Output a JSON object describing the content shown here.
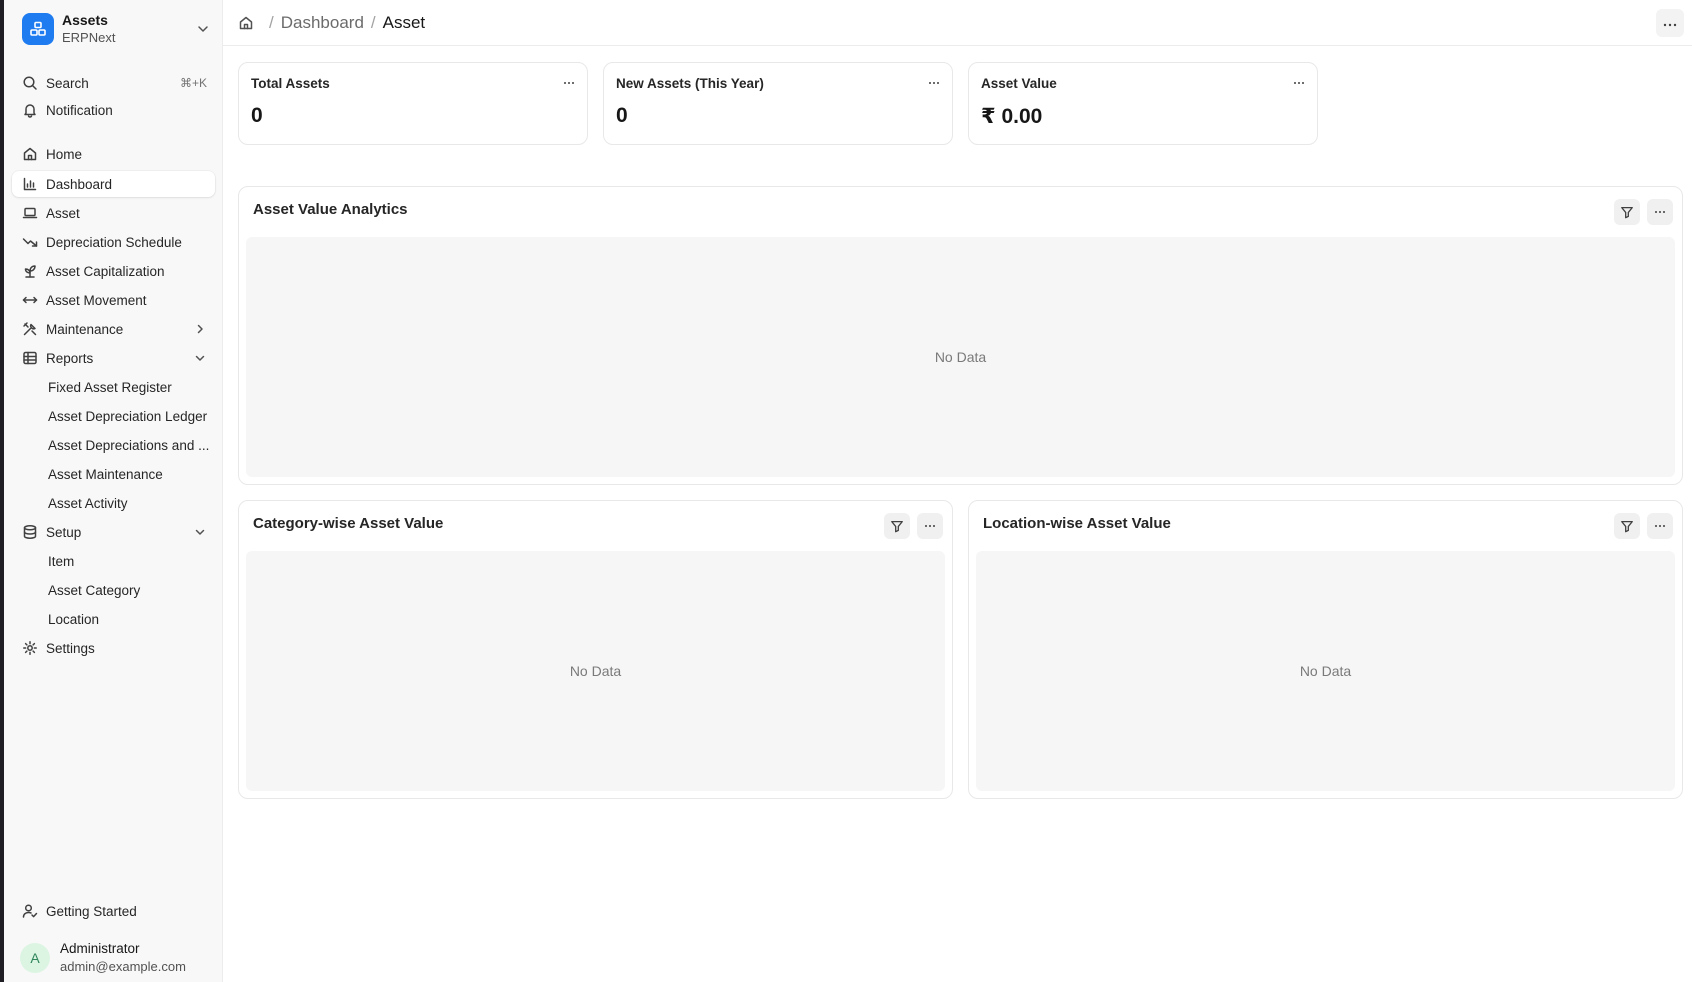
{
  "app": {
    "name": "Assets",
    "subtitle": "ERPNext",
    "brand_color": "#1f7cf0"
  },
  "sidebar": {
    "search_label": "Search",
    "search_shortcut": "⌘+K",
    "notification_label": "Notification",
    "items": [
      {
        "label": "Home",
        "icon": "home-icon"
      },
      {
        "label": "Dashboard",
        "icon": "bar-chart-icon",
        "active": true
      },
      {
        "label": "Asset",
        "icon": "laptop-icon"
      },
      {
        "label": "Depreciation Schedule",
        "icon": "trending-down-icon"
      },
      {
        "label": "Asset Capitalization",
        "icon": "sprout-icon"
      },
      {
        "label": "Asset Movement",
        "icon": "arrows-horizontal-icon"
      },
      {
        "label": "Maintenance",
        "icon": "tools-icon",
        "expanded": false
      },
      {
        "label": "Reports",
        "icon": "table-icon",
        "expanded": true
      }
    ],
    "reports": [
      "Fixed Asset Register",
      "Asset Depreciation Ledger",
      "Asset Depreciations and ...",
      "Asset Maintenance",
      "Asset Activity"
    ],
    "setup_label": "Setup",
    "setup_items": [
      "Item",
      "Asset Category",
      "Location"
    ],
    "settings_label": "Settings",
    "getting_started_label": "Getting Started"
  },
  "user": {
    "initial": "A",
    "name": "Administrator",
    "email": "admin@example.com"
  },
  "breadcrumb": {
    "parent": "Dashboard",
    "current": "Asset"
  },
  "number_cards": [
    {
      "title": "Total Assets",
      "value": "0"
    },
    {
      "title": "New Assets (This Year)",
      "value": "0"
    },
    {
      "title": "Asset Value",
      "value": "₹ 0.00"
    }
  ],
  "charts": [
    {
      "title": "Asset Value Analytics",
      "empty_text": "No Data"
    },
    {
      "title": "Category-wise Asset Value",
      "empty_text": "No Data"
    },
    {
      "title": "Location-wise Asset Value",
      "empty_text": "No Data"
    }
  ]
}
